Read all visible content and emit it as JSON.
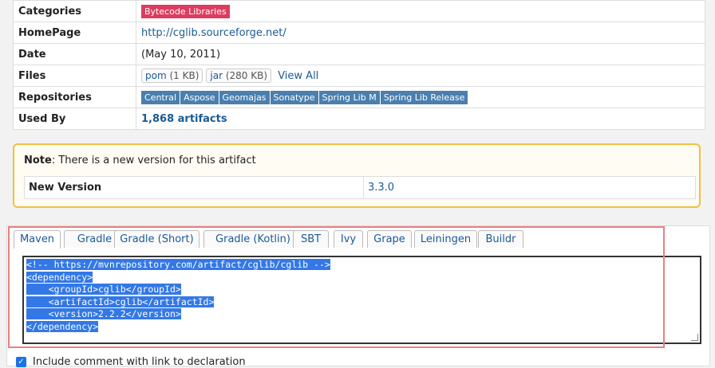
{
  "info": {
    "categories": {
      "label": "Categories",
      "tag": "Bytecode Libraries"
    },
    "homepage": {
      "label": "HomePage",
      "url": "http://cglib.sourceforge.net/"
    },
    "date": {
      "label": "Date",
      "value": "(May 10, 2011)"
    },
    "files": {
      "label": "Files",
      "items": [
        {
          "name": "pom",
          "size": "(1 KB)"
        },
        {
          "name": "jar",
          "size": "(280 KB)"
        }
      ],
      "view_all": "View All"
    },
    "repositories": {
      "label": "Repositories",
      "items": [
        "Central",
        "Aspose",
        "Geomajas",
        "Sonatype",
        "Spring Lib M",
        "Spring Lib Release"
      ]
    },
    "used_by": {
      "label": "Used By",
      "value": "1,868 artifacts"
    }
  },
  "note": {
    "prefix": "Note",
    "text": ": There is a new version for this artifact",
    "new_version_label": "New Version",
    "new_version_value": "3.3.0"
  },
  "tabs": [
    "Maven",
    "Gradle",
    "Gradle (Short)",
    "Gradle (Kotlin)",
    "SBT",
    "Ivy",
    "Grape",
    "Leiningen",
    "Buildr"
  ],
  "active_tab": "Maven",
  "code_lines": [
    "<!-- https://mvnrepository.com/artifact/cglib/cglib -->",
    "<dependency>",
    "    <groupId>cglib</groupId>",
    "    <artifactId>cglib</artifactId>",
    "    <version>2.2.2</version>",
    "</dependency>"
  ],
  "include_comment": {
    "checked": true,
    "label": "Include comment with link to declaration"
  },
  "colors": {
    "category_tag": "#dc3d5f",
    "repo_tag": "#4a7fae",
    "link": "#1a5a96",
    "selection": "#3378e6",
    "note_border": "#f0c040",
    "highlight_frame": "#e88080"
  }
}
